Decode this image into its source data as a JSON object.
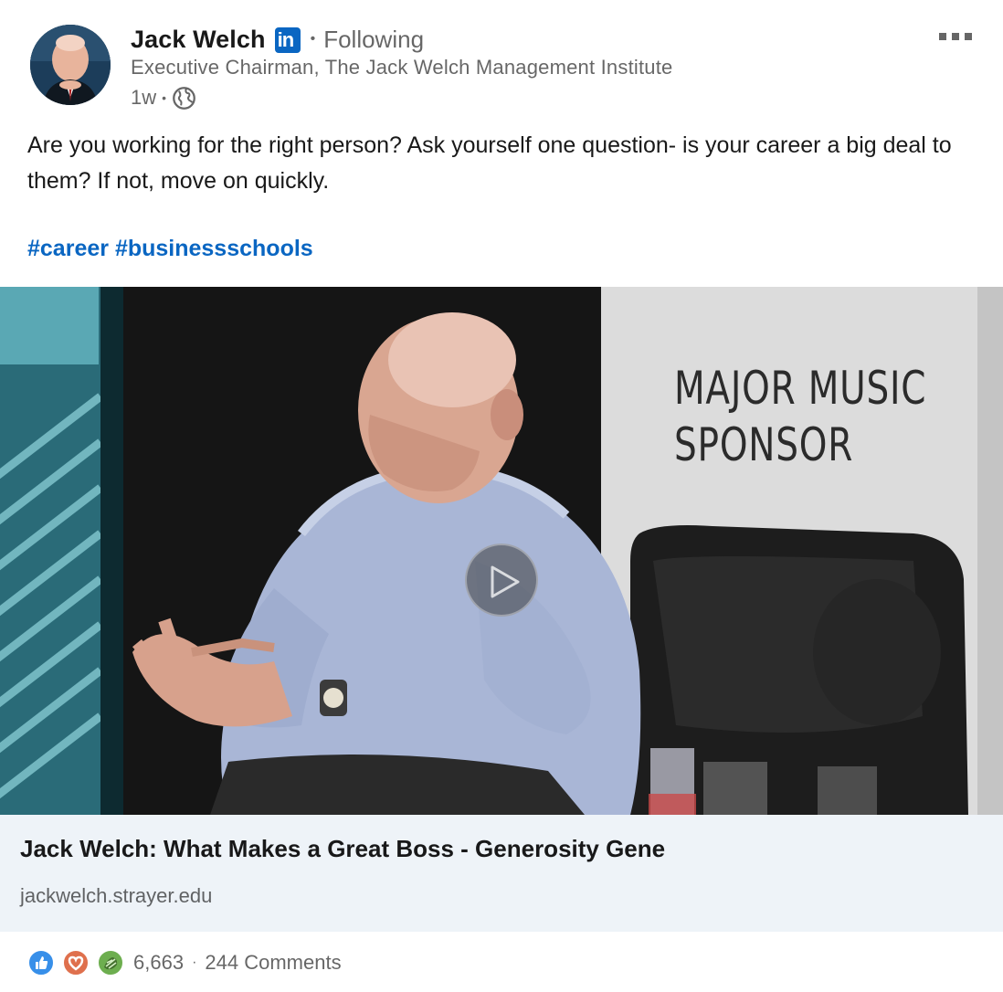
{
  "actor": {
    "name": "Jack Welch",
    "badge": "in",
    "follow_status": "Following",
    "headline": "Executive Chairman, The Jack Welch Management Institute",
    "time": "1w",
    "visibility_icon": "globe-icon"
  },
  "commentary": {
    "text": "Are you working for the right person? Ask yourself one question- is your career a big deal to them? If not, move on quickly.",
    "hashtags": [
      "#career",
      "#businessschools"
    ]
  },
  "video": {
    "sponsor_line1": "MAJOR MUSIC",
    "sponsor_line2": "SPONSOR",
    "play_icon": "play-icon"
  },
  "link_card": {
    "title": "Jack Welch: What Makes a Great Boss - Generosity Gene",
    "domain": "jackwelch.strayer.edu"
  },
  "social": {
    "reactions": [
      "like-icon",
      "love-icon",
      "celebrate-icon"
    ],
    "reaction_count": "6,663",
    "separator": "·",
    "comments": "244 Comments"
  },
  "colors": {
    "link_blue": "#0a66c2",
    "card_bg": "#eef3f8",
    "like": "#378fe9",
    "love": "#df704d",
    "celebrate": "#44712e"
  }
}
